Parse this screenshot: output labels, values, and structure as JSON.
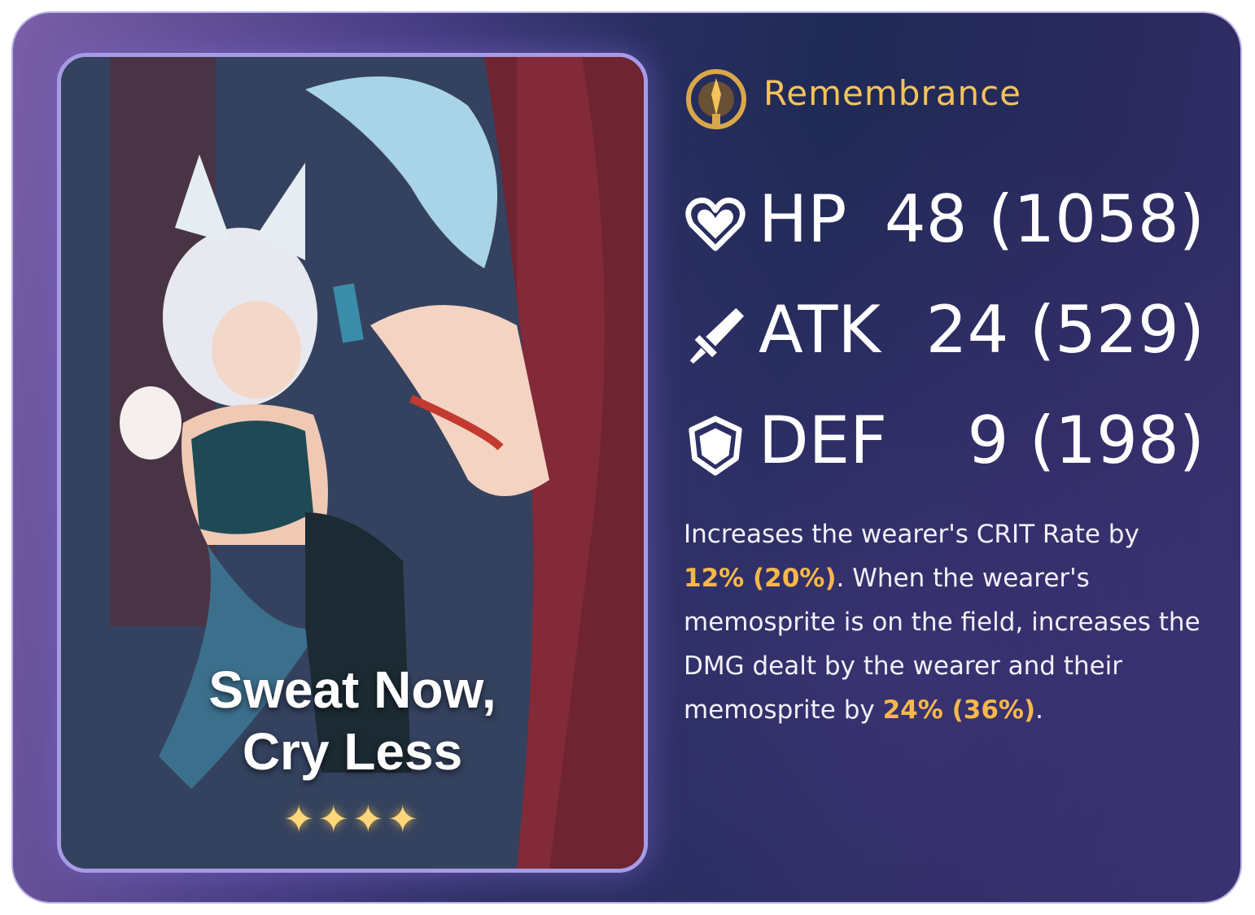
{
  "light_cone": {
    "title_line1": "Sweat Now,",
    "title_line2": "Cry Less",
    "stars": "✦✦✦✦",
    "rarity": 4
  },
  "path": {
    "label": "Remembrance",
    "icon": "remembrance-path-icon"
  },
  "stats": [
    {
      "name": "HP",
      "value": "48 (1058)",
      "icon": "heart-icon"
    },
    {
      "name": "ATK",
      "value": "24 (529)",
      "icon": "sword-icon"
    },
    {
      "name": "DEF",
      "value": "9 (198)",
      "icon": "shield-icon"
    }
  ],
  "description": {
    "part1": "Increases the wearer's CRIT Rate by ",
    "hl1": "12% (20%)",
    "part2": ". When the wearer's memosprite is on the field, increases the DMG dealt by the wearer and their memosprite by ",
    "hl2": "24% (36%)",
    "part3": "."
  },
  "colors": {
    "accent": "#f5c25a",
    "highlight": "#f7b84a",
    "frame_border": "#b9b2e6",
    "card_border": "#a79be6"
  }
}
